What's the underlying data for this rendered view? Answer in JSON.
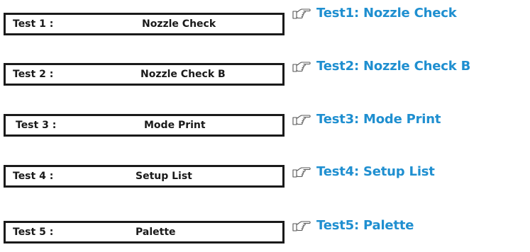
{
  "tests": [
    {
      "label": "Test 1 :",
      "mode": "Nozzle Check",
      "link": "Test1: Nozzle Check"
    },
    {
      "label": "Test 2 :",
      "mode": "Nozzle Check B",
      "link": "Test2: Nozzle Check B"
    },
    {
      "label": "Test 3 :",
      "mode": "Mode Print",
      "link": "Test3: Mode Print"
    },
    {
      "label": "Test 4 :",
      "mode": "Setup List",
      "link": "Test4: Setup List"
    },
    {
      "label": "Test 5 :",
      "mode": "Palette",
      "link": "Test5: Palette"
    }
  ],
  "icon": "pointing-hand-icon",
  "colors": {
    "link": "#1f8fd0",
    "border": "#1a1a1a"
  }
}
